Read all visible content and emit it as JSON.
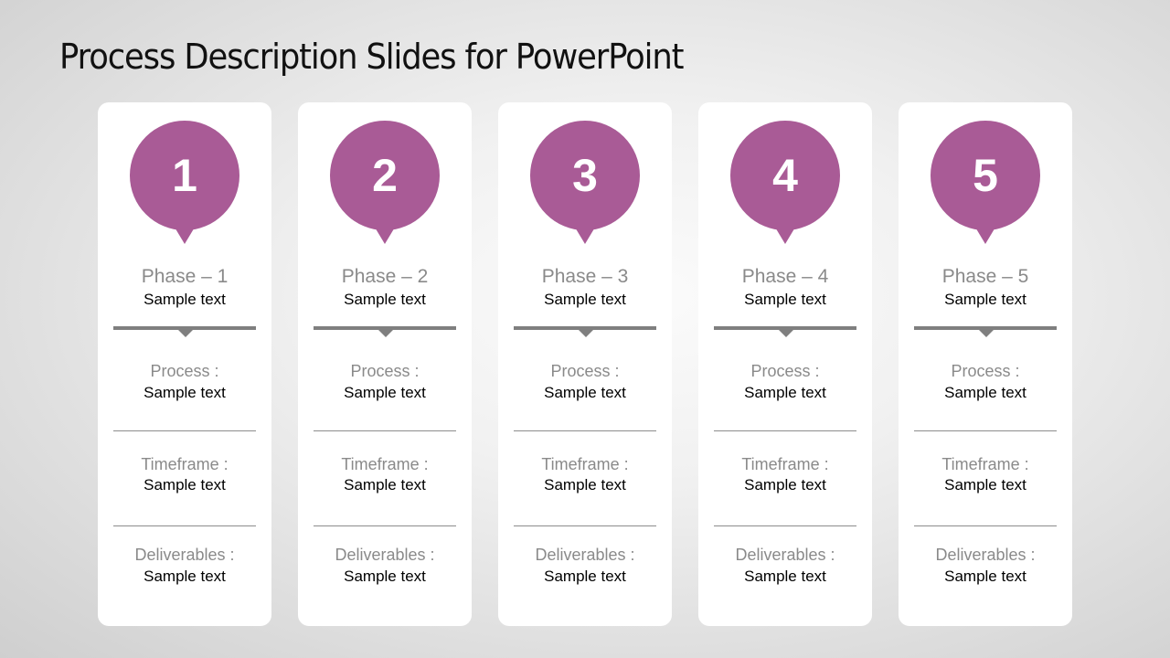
{
  "slide": {
    "title": "Process Description Slides for PowerPoint",
    "accent_color": "#A95B96",
    "phases": [
      {
        "number": "1",
        "title": "Phase – 1",
        "subtitle": "Sample text",
        "process_label": "Process :",
        "process_value": "Sample text",
        "timeframe_label": "Timeframe :",
        "timeframe_value": "Sample text",
        "deliverables_label": "Deliverables :",
        "deliverables_value": "Sample text"
      },
      {
        "number": "2",
        "title": "Phase – 2",
        "subtitle": "Sample text",
        "process_label": "Process :",
        "process_value": "Sample text",
        "timeframe_label": "Timeframe :",
        "timeframe_value": "Sample text",
        "deliverables_label": "Deliverables :",
        "deliverables_value": "Sample text"
      },
      {
        "number": "3",
        "title": "Phase – 3",
        "subtitle": "Sample text",
        "process_label": "Process :",
        "process_value": "Sample text",
        "timeframe_label": "Timeframe :",
        "timeframe_value": "Sample text",
        "deliverables_label": "Deliverables :",
        "deliverables_value": "Sample text"
      },
      {
        "number": "4",
        "title": "Phase – 4",
        "subtitle": "Sample text",
        "process_label": "Process :",
        "process_value": "Sample text",
        "timeframe_label": "Timeframe :",
        "timeframe_value": "Sample text",
        "deliverables_label": "Deliverables :",
        "deliverables_value": "Sample text"
      },
      {
        "number": "5",
        "title": "Phase – 5",
        "subtitle": "Sample text",
        "process_label": "Process :",
        "process_value": "Sample text",
        "timeframe_label": "Timeframe :",
        "timeframe_value": "Sample text",
        "deliverables_label": "Deliverables :",
        "deliverables_value": "Sample text"
      }
    ]
  }
}
